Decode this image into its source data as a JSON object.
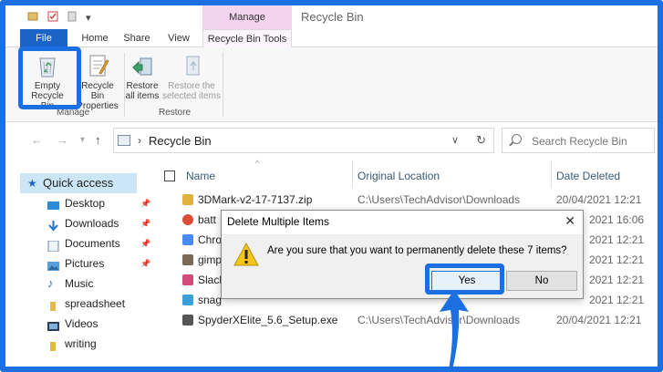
{
  "window": {
    "title": "Recycle Bin",
    "context_tab": "Manage"
  },
  "ribbon": {
    "tabs": [
      "File",
      "Home",
      "Share",
      "View",
      "Recycle Bin Tools"
    ],
    "buttons": {
      "empty_recycle_bin": "Empty Recycle Bin",
      "recycle_bin_properties": "Recycle Bin Properties",
      "restore_all_items": "Restore all items",
      "restore_selected_items": "Restore the selected items"
    },
    "groups": [
      "Manage",
      "Restore"
    ]
  },
  "navigation": {
    "address": "Recycle Bin",
    "search_placeholder": "Search Recycle Bin"
  },
  "sidebar": {
    "items": [
      {
        "label": "Quick access",
        "icon": "star-icon",
        "pinned": false
      },
      {
        "label": "Desktop",
        "icon": "desktop-icon",
        "pinned": true
      },
      {
        "label": "Downloads",
        "icon": "download-icon",
        "pinned": true
      },
      {
        "label": "Documents",
        "icon": "documents-icon",
        "pinned": true
      },
      {
        "label": "Pictures",
        "icon": "pictures-icon",
        "pinned": true
      },
      {
        "label": "Music",
        "icon": "music-icon",
        "pinned": false
      },
      {
        "label": "spreadsheet",
        "icon": "folder-icon",
        "pinned": false
      },
      {
        "label": "Videos",
        "icon": "videos-icon",
        "pinned": false
      },
      {
        "label": "writing",
        "icon": "folder-icon",
        "pinned": false
      }
    ]
  },
  "file_list": {
    "columns": [
      "Name",
      "Original Location",
      "Date Deleted"
    ],
    "rows": [
      {
        "name": "3DMark-v2-17-7137.zip",
        "location": "C:\\Users\\TechAdvisor\\Downloads",
        "date": "20/04/2021 12:21",
        "icon_color": "#e0b43c"
      },
      {
        "name": "batt",
        "location": "",
        "date": "2021 16:06",
        "icon_color": "#dd4b39"
      },
      {
        "name": "Chro",
        "location": "",
        "date": "2021 12:21",
        "icon_color": "#4a8af4"
      },
      {
        "name": "gimp",
        "location": "",
        "date": "2021 12:21",
        "icon_color": "#7a6a55"
      },
      {
        "name": "Slack",
        "location": "",
        "date": "2021 12:21",
        "icon_color": "#d44a7b"
      },
      {
        "name": "snag",
        "location": "",
        "date": "2021 12:21",
        "icon_color": "#3aa0d8"
      },
      {
        "name": "SpyderXElite_5.6_Setup.exe",
        "location": "C:\\Users\\TechAdvisor\\Downloads",
        "date": "20/04/2021 12:21",
        "icon_color": "#555555"
      }
    ]
  },
  "dialog": {
    "title": "Delete Multiple Items",
    "message": "Are you sure that you want to permanently delete these 7 items?",
    "yes_label": "Yes",
    "no_label": "No"
  },
  "colors": {
    "highlight": "#1b6fe0",
    "file_tab": "#1c63c7",
    "manage_tab": "#f2d4ef"
  }
}
